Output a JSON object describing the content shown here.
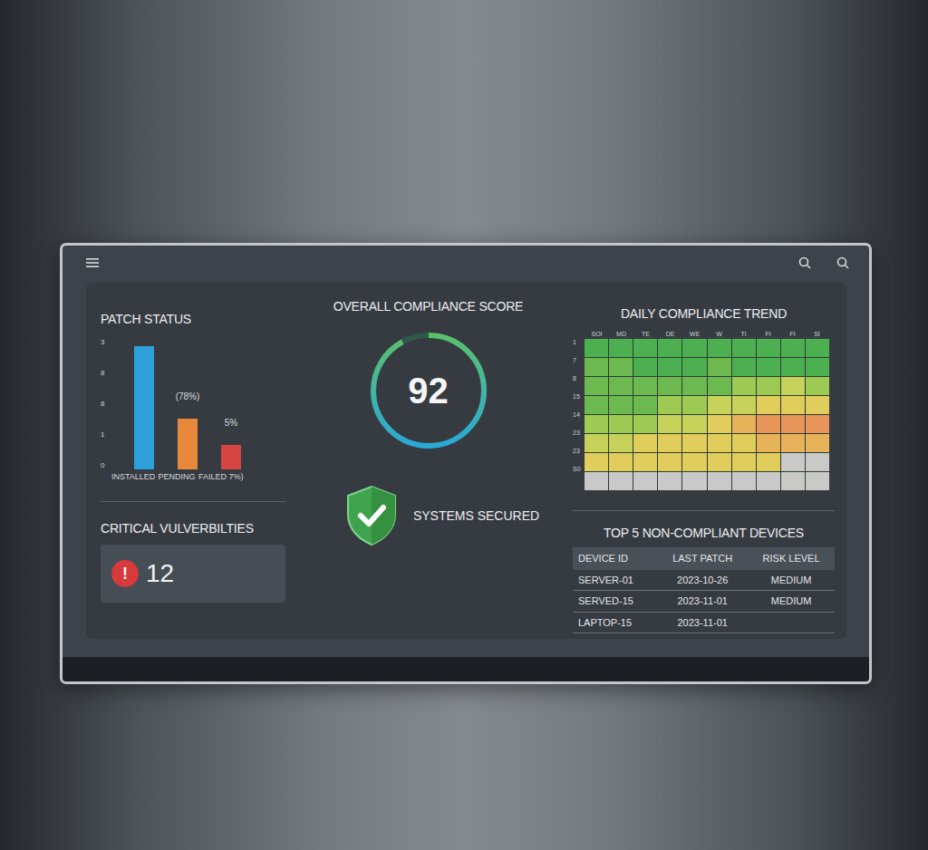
{
  "patch_status": {
    "title": "PATCH STATUS",
    "y_ticks": [
      "3",
      "8",
      "8",
      "1",
      "0"
    ],
    "axis_max": 4,
    "bars": [
      {
        "label": "INSTALLED",
        "value": 3.78,
        "color": "#2d9fd9"
      },
      {
        "label": "PENDING",
        "value": 1.56,
        "annotation": "(78%)",
        "color": "#e8883a"
      },
      {
        "label": "FAILED 7%)",
        "value": 0.75,
        "annotation": "5%",
        "color": "#d64541"
      }
    ]
  },
  "critical": {
    "title": "CRITICAL VULVERBILTIES",
    "icon": "!",
    "count": "12"
  },
  "compliance": {
    "title": "OVERALL COMPLIANCE SCORE",
    "score": "92",
    "level": 0.92,
    "status": "SYSTEMS SECURED"
  },
  "trend": {
    "title": "DAILY COMPLIANCE TREND",
    "columns": [
      "SOI",
      "MD",
      "TE",
      "DE",
      "WE",
      "W",
      "TI",
      "FI",
      "FI",
      "SI"
    ],
    "row_labels": [
      "1",
      "7",
      "8",
      "15",
      "14",
      "23",
      "23",
      "S0"
    ],
    "values": [
      [
        95,
        95,
        96,
        95,
        96,
        96,
        97,
        97,
        98,
        98
      ],
      [
        94,
        94,
        95,
        95,
        95,
        94,
        95,
        96,
        97,
        97
      ],
      [
        93,
        93,
        94,
        94,
        93,
        92,
        90,
        88,
        86,
        88
      ],
      [
        92,
        92,
        92,
        90,
        88,
        86,
        84,
        82,
        80,
        82
      ],
      [
        90,
        89,
        88,
        86,
        84,
        82,
        78,
        75,
        72,
        74
      ],
      [
        85,
        84,
        82,
        80,
        80,
        80,
        80,
        78,
        76,
        78
      ],
      [
        80,
        80,
        80,
        80,
        80,
        80,
        80,
        82,
        null,
        null
      ],
      [
        null,
        null,
        null,
        null,
        null,
        null,
        null,
        null,
        null,
        null
      ]
    ]
  },
  "devices": {
    "title": "TOP 5 NON-COMPLIANT DEVICES",
    "columns": [
      "DEVICE ID",
      "LAST PATCH",
      "RISK LEVEL"
    ],
    "rows": [
      [
        "SERVER-01",
        "2023-10-26",
        "MEDIUM"
      ],
      [
        "SERVED-15",
        "2023-11-01",
        "MEDIUM"
      ],
      [
        "LAPTOP-15",
        "2023-11-01",
        ""
      ]
    ]
  }
}
